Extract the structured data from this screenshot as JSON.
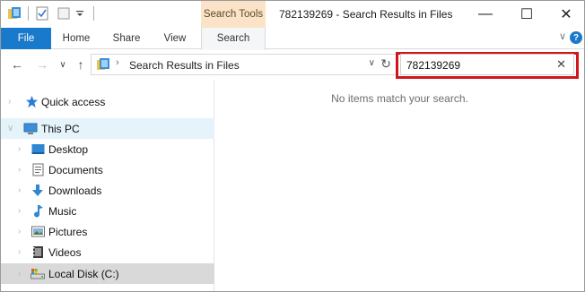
{
  "window": {
    "title": "782139269 - Search Results in Files",
    "contextual_tab": "Search Tools",
    "controls": {
      "minimize": "—",
      "maximize": "☐",
      "close": "✕"
    }
  },
  "ribbon": {
    "tabs": [
      {
        "label": "File"
      },
      {
        "label": "Home"
      },
      {
        "label": "Share"
      },
      {
        "label": "View"
      },
      {
        "label": "Search"
      }
    ],
    "help": "?",
    "collapse": "∨"
  },
  "address": {
    "path": "Search Results in Files",
    "crumb_sep": "›",
    "back": "←",
    "forward": "→",
    "recent": "∨",
    "up": "↑",
    "dropdown": "∨",
    "refresh": "↻"
  },
  "search": {
    "value": "782139269",
    "clear": "✕"
  },
  "nav": {
    "items": [
      {
        "label": "Quick access",
        "icon": "star-icon"
      },
      {
        "label": "This PC",
        "icon": "computer-icon"
      },
      {
        "label": "Desktop",
        "icon": "desktop-icon"
      },
      {
        "label": "Documents",
        "icon": "documents-icon"
      },
      {
        "label": "Downloads",
        "icon": "downloads-icon"
      },
      {
        "label": "Music",
        "icon": "music-icon"
      },
      {
        "label": "Pictures",
        "icon": "pictures-icon"
      },
      {
        "label": "Videos",
        "icon": "videos-icon"
      },
      {
        "label": "Local Disk (C:)",
        "icon": "local-disk-icon"
      }
    ],
    "arrow_collapsed": "›",
    "arrow_expanded": "∨"
  },
  "content": {
    "empty_message": "No items match your search."
  },
  "colors": {
    "file_tab": "#1979ca",
    "context_tab": "#fbe3c7",
    "highlight": "#d3141c",
    "selected": "#e5f3fb"
  }
}
